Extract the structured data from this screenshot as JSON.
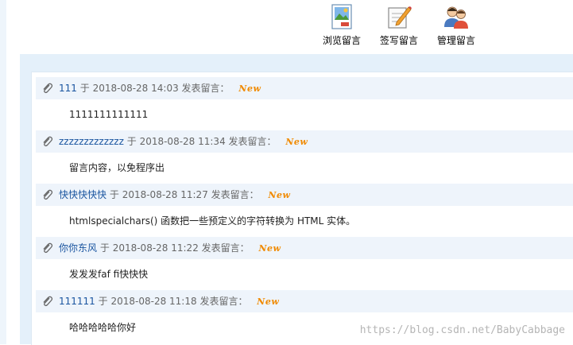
{
  "toolbar": {
    "browse": {
      "label": "浏览留言",
      "icon": "browse-picture-icon"
    },
    "write": {
      "label": "签写留言",
      "icon": "write-notepad-icon"
    },
    "manage": {
      "label": "管理留言",
      "icon": "manage-users-icon"
    }
  },
  "messages": [
    {
      "author": "111",
      "prefix": "于",
      "date": "2018-08-28 14:03",
      "suffix": "发表留言：",
      "badge": "New",
      "content": "1111111111111"
    },
    {
      "author": "zzzzzzzzzzzzz",
      "prefix": "于",
      "date": "2018-08-28 11:34",
      "suffix": "发表留言：",
      "badge": "New",
      "content": "留言内容，以免程序出"
    },
    {
      "author": "快快快快快",
      "prefix": "于",
      "date": "2018-08-28 11:27",
      "suffix": "发表留言：",
      "badge": "New",
      "content": "htmlspecialchars() 函数把一些预定义的字符转换为 HTML 实体。"
    },
    {
      "author": "你你东风",
      "prefix": "于",
      "date": "2018-08-28 11:22",
      "suffix": "发表留言：",
      "badge": "New",
      "content": "发发发faf fi快快快"
    },
    {
      "author": "111111",
      "prefix": "于",
      "date": "2018-08-28 11:18",
      "suffix": "发表留言：",
      "badge": "New",
      "content": "哈哈哈哈哈你好"
    }
  ],
  "watermark": "https://blog.csdn.net/BabyCabbage",
  "colors": {
    "header_bg": "#eef4fb",
    "panel_bg": "#e4f0fa",
    "author": "#1a55a0",
    "badge": "#f08a00"
  }
}
